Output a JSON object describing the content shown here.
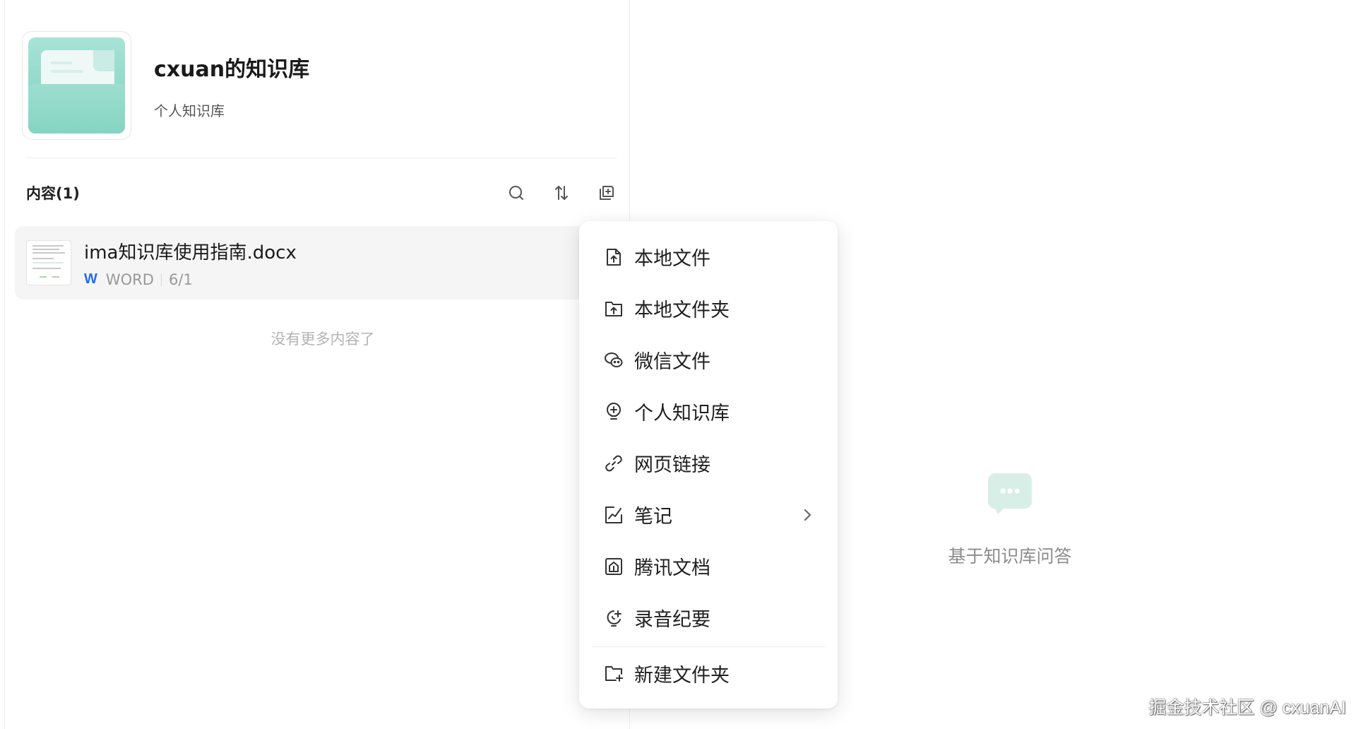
{
  "knowledge_base": {
    "title": "cxuan的知识库",
    "subtitle": "个人知识库"
  },
  "content": {
    "label": "内容(1)",
    "tools": [
      "search-icon",
      "sort-icon",
      "add-content-icon"
    ]
  },
  "files": [
    {
      "name": "ima知识库使用指南.docx",
      "type_icon": "W",
      "type": "WORD",
      "date": "6/1"
    }
  ],
  "no_more_text": "没有更多内容了",
  "qa_panel": {
    "empty_text": "基于知识库问答"
  },
  "menu": {
    "items": [
      {
        "label": "本地文件",
        "icon": "file-upload-icon"
      },
      {
        "label": "本地文件夹",
        "icon": "folder-upload-icon"
      },
      {
        "label": "微信文件",
        "icon": "wechat-icon"
      },
      {
        "label": "个人知识库",
        "icon": "knowledge-bulb-icon"
      },
      {
        "label": "网页链接",
        "icon": "link-icon"
      },
      {
        "label": "笔记",
        "icon": "note-icon",
        "has_submenu": true
      },
      {
        "label": "腾讯文档",
        "icon": "tencent-docs-icon"
      },
      {
        "label": "录音纪要",
        "icon": "recording-icon"
      }
    ],
    "footer_item": {
      "label": "新建文件夹",
      "icon": "new-folder-icon"
    }
  },
  "watermark": "掘金技术社区 @ cxuanAI",
  "colors": {
    "accent_teal": "#7fd1c0",
    "word_blue": "#1f6ff2",
    "row_bg": "#f5f5f5",
    "muted_text": "#b3b3b3"
  }
}
